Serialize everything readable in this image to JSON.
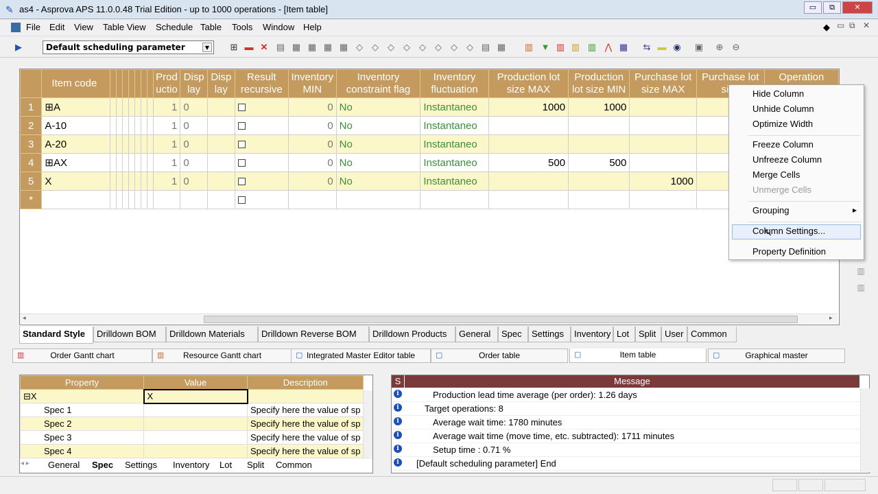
{
  "window": {
    "title": "as4 - Asprova APS 11.0.0.48 Trial Edition  - up to 1000 operations - [Item table]",
    "minimize": "▭",
    "restore": "⧉",
    "close": "✕"
  },
  "menu": [
    "File",
    "Edit",
    "View",
    "Table View",
    "Schedule",
    "Table",
    "Tools",
    "Window",
    "Help"
  ],
  "toolbar": {
    "param": "Default scheduling parameter"
  },
  "table": {
    "headers": [
      "Item code",
      "Prod uctio",
      "Disp lay",
      "Disp lay",
      "Result recursive",
      "Inventory MIN",
      "Inventory constraint flag",
      "Inventory fluctuation",
      "Production lot size MAX",
      "Production lot size MIN",
      "Purchase lot size MAX",
      "Purchase lot size",
      "Operation"
    ],
    "rows": [
      {
        "n": "1",
        "code": "⊞A",
        "prod": "1",
        "disp": "0",
        "inv": "0",
        "flag": "No",
        "fluct": "Instantaneo",
        "pmax": "1000",
        "pmin": "1000",
        "pur": ""
      },
      {
        "n": "2",
        "code": "A-10",
        "prod": "1",
        "disp": "0",
        "inv": "0",
        "flag": "No",
        "fluct": "Instantaneo",
        "pmax": "",
        "pmin": "",
        "pur": ""
      },
      {
        "n": "3",
        "code": "A-20",
        "prod": "1",
        "disp": "0",
        "inv": "0",
        "flag": "No",
        "fluct": "Instantaneo",
        "pmax": "",
        "pmin": "",
        "pur": ""
      },
      {
        "n": "4",
        "code": "⊞AX",
        "prod": "1",
        "disp": "0",
        "inv": "0",
        "flag": "No",
        "fluct": "Instantaneo",
        "pmax": "500",
        "pmin": "500",
        "pur": ""
      },
      {
        "n": "5",
        "code": "X",
        "prod": "1",
        "disp": "0",
        "inv": "0",
        "flag": "No",
        "fluct": "Instantaneo",
        "pmax": "",
        "pmin": "",
        "pur": "1000"
      },
      {
        "n": "*",
        "code": "",
        "prod": "",
        "disp": "",
        "inv": "",
        "flag": "",
        "fluct": "",
        "pmax": "",
        "pmin": "",
        "pur": ""
      }
    ]
  },
  "context_menu": {
    "items": [
      "Hide Column",
      "Unhide Column",
      "Optimize Width",
      "Freeze Column",
      "Unfreeze Column",
      "Merge Cells",
      "Unmerge Cells",
      "Grouping",
      "Column Settings...",
      "Property Definition"
    ],
    "grouping_arrow": "▸"
  },
  "view_tabs": [
    "Standard Style",
    "Drilldown BOM",
    "Drilldown Materials",
    "Drilldown Reverse BOM",
    "Drilldown Products",
    "General",
    "Spec",
    "Settings",
    "Inventory",
    "Lot",
    "Split",
    "User",
    "Common"
  ],
  "window_tabs": [
    "Order Gantt chart",
    "Resource Gantt chart",
    "Integrated Master Editor table",
    "Order table",
    "Item table",
    "Graphical master"
  ],
  "property_panel": {
    "headers": [
      "Property",
      "Value",
      "Description"
    ],
    "rows": [
      {
        "p": "⊟X",
        "v": "X",
        "d": ""
      },
      {
        "p": "Spec 1",
        "v": "",
        "d": "Specify here the value of sp"
      },
      {
        "p": "Spec 2",
        "v": "",
        "d": "Specify here the value of sp"
      },
      {
        "p": "Spec 3",
        "v": "",
        "d": "Specify here the value of sp"
      },
      {
        "p": "Spec 4",
        "v": "",
        "d": "Specify here the value of sp"
      }
    ],
    "tabs": [
      "General",
      "Spec",
      "Settings",
      "Inventory",
      "Lot",
      "Split",
      "Common"
    ]
  },
  "message_panel": {
    "col_s": "S",
    "col_msg": "Message",
    "rows": [
      "Production lead time average (per order): 1.26 days",
      "Target operations: 8",
      "Average wait time: 1780 minutes",
      "Average wait time (move time, etc. subtracted): 1711 minutes",
      "Setup time : 0.71 %",
      "[Default scheduling parameter] End"
    ]
  }
}
